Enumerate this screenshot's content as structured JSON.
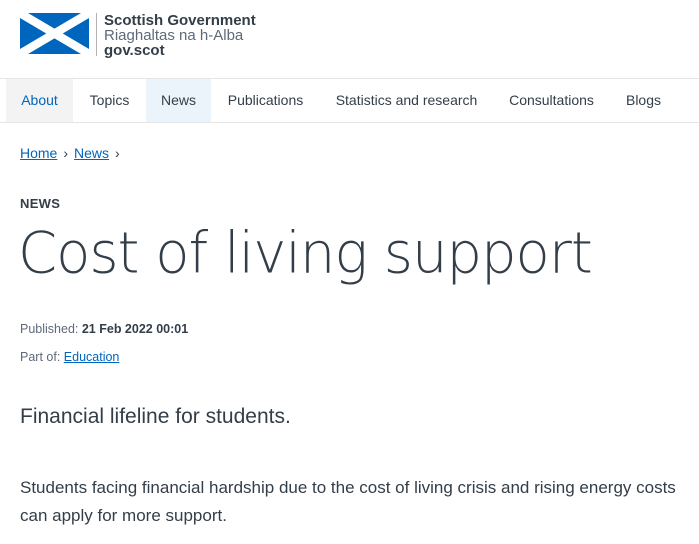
{
  "logo": {
    "line1": "Scottish Government",
    "line2": "Riaghaltas na h-Alba",
    "line3": "gov.scot",
    "flag_blue": "#0065bd"
  },
  "nav": {
    "items": [
      {
        "label": "About"
      },
      {
        "label": "Topics"
      },
      {
        "label": "News"
      },
      {
        "label": "Publications"
      },
      {
        "label": "Statistics and research"
      },
      {
        "label": "Consultations"
      },
      {
        "label": "Blogs"
      }
    ]
  },
  "breadcrumb": {
    "home": "Home",
    "news": "News",
    "separator": "›"
  },
  "article": {
    "label": "NEWS",
    "title": "Cost of living support",
    "published_label": "Published:",
    "published_value": "21 Feb 2022 00:01",
    "part_of_label": "Part of:",
    "part_of_link": "Education",
    "lead": "Financial lifeline for students.",
    "body": "Students facing financial hardship due to the cost of living crisis and rising energy costs can apply for more support."
  },
  "colors": {
    "link": "#0065bd",
    "text": "#333e48",
    "nav_active_bg": "#ebf4fb"
  }
}
